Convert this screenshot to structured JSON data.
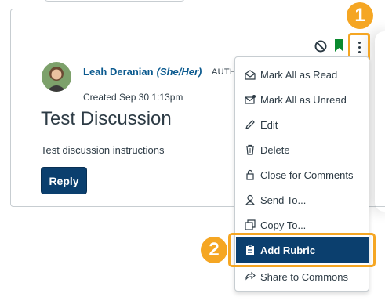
{
  "post": {
    "author_name": "Leah Deranian",
    "author_pronouns": "(She/Her)",
    "author_role": "AUTHOR",
    "created": "Created Sep 30 1:13pm",
    "title": "Test Discussion",
    "description": "Test discussion instructions",
    "reply_label": "Reply"
  },
  "callouts": {
    "step1": "1",
    "step2": "2"
  },
  "menu": {
    "items": [
      {
        "label": "Mark All as Read",
        "icon": "envelope-open-icon"
      },
      {
        "label": "Mark All as Unread",
        "icon": "envelope-unread-icon"
      },
      {
        "label": "Edit",
        "icon": "pencil-icon"
      },
      {
        "label": "Delete",
        "icon": "trash-icon"
      },
      {
        "label": "Close for Comments",
        "icon": "lock-icon"
      },
      {
        "label": "Send To...",
        "icon": "user-send-icon"
      },
      {
        "label": "Copy To...",
        "icon": "copy-icon"
      },
      {
        "label": "Add Rubric",
        "icon": "clipboard-icon",
        "active": true
      },
      {
        "label": "Share to Commons",
        "icon": "share-commons-icon"
      }
    ]
  },
  "colors": {
    "accent": "#f5a623",
    "primary": "#0b3f6e",
    "link": "#0b5a8f",
    "bookmark": "#0a8a2f"
  }
}
